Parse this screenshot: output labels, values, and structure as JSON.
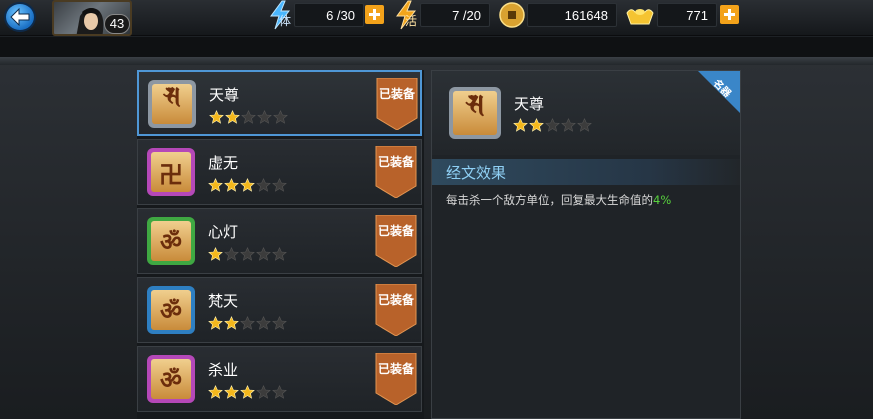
{
  "header": {
    "level": "43",
    "stamina": {
      "value": "6 /30",
      "label": "体"
    },
    "energy": {
      "value": "7 /20",
      "label": "活"
    },
    "coins": "161648",
    "gold": "771"
  },
  "list": [
    {
      "name": "天尊",
      "stars": 2,
      "glyph": "𑖭",
      "frame_color": "#8d97a2",
      "tag": "已装备",
      "selected": true
    },
    {
      "name": "虚无",
      "stars": 3,
      "glyph": "卍",
      "frame_color": "#b548b8",
      "tag": "已装备",
      "selected": false
    },
    {
      "name": "心灯",
      "stars": 1,
      "glyph": "ॐ",
      "frame_color": "#3fa842",
      "tag": "已装备",
      "selected": false
    },
    {
      "name": "梵天",
      "stars": 2,
      "glyph": "ॐ",
      "frame_color": "#2e7fc2",
      "tag": "已装备",
      "selected": false
    },
    {
      "name": "杀业",
      "stars": 3,
      "glyph": "ॐ",
      "frame_color": "#b548b8",
      "tag": "已装备",
      "selected": false
    }
  ],
  "detail": {
    "name": "天尊",
    "stars": 2,
    "corner_label": "名器",
    "effect_title": "经文效果",
    "effect_desc": "每击杀一个敌方单位，回复最大生命值的",
    "effect_value": "4%"
  },
  "colors": {
    "accent": "#4f97d6",
    "ribbon": "#b8622a",
    "star_on": "#f4b81c",
    "star_off": "#3c3c3c",
    "highlight_value": "#58d13e"
  }
}
